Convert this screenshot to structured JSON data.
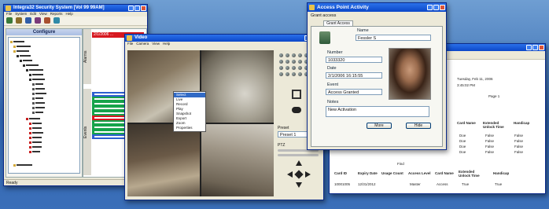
{
  "main_window": {
    "title": "Integra32 Security System [Vol 99 99AM]",
    "menu": [
      "File",
      "System",
      "Edit",
      "View",
      "Reports",
      "Help"
    ],
    "toolbar": [
      "Log Off",
      "Tools",
      "Config",
      "Setup",
      "Reports",
      "Help"
    ],
    "config_header": "Configure",
    "tree_items": [
      "Site",
      "Panel",
      "Reader",
      "Inputs",
      "Outputs",
      "Doors",
      "Cameras",
      "Users"
    ],
    "events_label": "Events",
    "alarms_label": "Alarms",
    "status": "Ready",
    "events_alert_text": "2/1/2006 ...",
    "colors": {
      "alert_red": "#d71920",
      "event_green": "#16a34a",
      "event_blue": "#2d5fd0"
    }
  },
  "camera_window": {
    "title": "Video",
    "menu": [
      "File",
      "Camera",
      "View",
      "Help"
    ],
    "context_menu": [
      "Select",
      "Live",
      "Record",
      "Play",
      "Snapshot",
      "Export",
      "Zoom",
      "Properties"
    ],
    "preset_label": "Preset",
    "preset_value": "Preset 1",
    "ptz_label": "PTZ"
  },
  "access_window": {
    "title": "Access Point Activity",
    "subtitle": "Grant access",
    "tab": "Grant Access",
    "name_label": "Name",
    "name_value": "Fessler S",
    "number_label": "Number",
    "number_value": "1033320",
    "date_label": "Date",
    "date_value": "2/1/2006 16:15:55",
    "event_label": "Event",
    "event_value": "Access Granted",
    "notes_label": "Notes",
    "notes_value": "New Activation",
    "btn_more": "More",
    "btn_hide": "Hide"
  },
  "report_window": {
    "header_date": "Tuesday, Feb 11, 2006",
    "header_time": "3:45:02 PM",
    "page_label": "Page 1",
    "find_label": "Find",
    "right_columns": [
      "Card Name",
      "Extended Unlock Time",
      "Handicap"
    ],
    "right_rows": [
      [
        "Doe",
        "False",
        "False"
      ],
      [
        "Doe",
        "False",
        "False"
      ],
      [
        "Doe",
        "False",
        "False"
      ],
      [
        "Doe",
        "False",
        "False"
      ]
    ],
    "bottom_columns": [
      "Card ID",
      "Expiry Date",
      "Usage Count",
      "Access Level",
      "Card Name",
      "Extended Unlock Time",
      "Handicap"
    ],
    "bottom_rows": [
      [
        "10001005",
        "12/31/2012",
        "",
        "Master",
        "Access",
        "True",
        "True"
      ]
    ]
  }
}
